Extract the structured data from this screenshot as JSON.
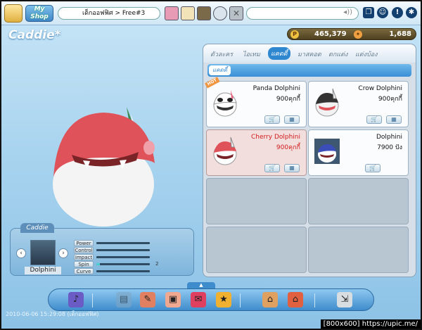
{
  "topbar": {
    "myshop_label": "My Shop",
    "room_name": "เด็กออฟฟิศ > Free#3",
    "avatar_slots": [
      "pink-hair-avatar",
      "cat-avatar",
      "brown-avatar",
      "ball-avatar",
      "close-slot"
    ]
  },
  "caddie_title": "Caddie*",
  "currency": {
    "pang": "465,379",
    "cookie": "1,688"
  },
  "stat_box": {
    "tab_label": "Caddie",
    "name": "Dolphini",
    "stats": [
      {
        "label": "Power",
        "value": "",
        "level": 0
      },
      {
        "label": "Control",
        "value": "",
        "level": 0
      },
      {
        "label": "Impact",
        "value": "",
        "level": 0
      },
      {
        "label": "Spin",
        "value": "2",
        "level": 0.06
      },
      {
        "label": "Curve",
        "value": "",
        "level": 0
      }
    ]
  },
  "shop": {
    "tabs": [
      "ตัวละคร",
      "ไอเทม",
      "แคดดี้",
      "มาสคอต",
      "ตกแต่ง",
      "แต่งบ้อง"
    ],
    "active_tab": "แคดดี้",
    "subtab": "แคดดี้",
    "items": [
      {
        "name": "Panda Dolphini",
        "price": "900คุกกี้",
        "badge": "HOT"
      },
      {
        "name": "Crow Dolphini",
        "price": "900คุกกี้"
      },
      {
        "name": "Cherry Dolphini",
        "price": "900คุกกี้",
        "selected": true
      },
      {
        "name": "Dolphini",
        "price": "7900 ปัง"
      }
    ]
  },
  "timestamp": "2010-06-06 15:29:08 (เด็กออฟฟิศ)",
  "watermark": "[800x600] https://upic.me/",
  "colors": {
    "selected_text": "#d21b1b",
    "accent_blue": "#2f87d0",
    "character_red": "#e0525a"
  }
}
